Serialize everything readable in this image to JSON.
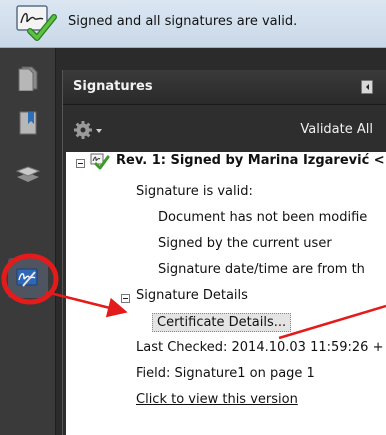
{
  "message_bar": {
    "text": "Signed and all signatures are valid."
  },
  "panel": {
    "title": "Signatures",
    "validate_all_label": "Validate All"
  },
  "signature_tree": {
    "revision_label": "Rev. 1: Signed by Marina Izgarević <",
    "signature_valid": "Signature is valid:",
    "doc_not_modified": "Document has not been modifie",
    "signed_by_current_user": "Signed by the current user",
    "signature_datetime": "Signature date/time are from th",
    "signature_details": "Signature Details",
    "certificate_details": "Certificate Details...",
    "last_checked": "Last Checked: 2014.10.03 11:59:26 +",
    "field": "Field: Signature1 on page 1",
    "click_to_view": "Click to view this version"
  },
  "icons": {
    "message_bar_icon": "signature-valid-icon",
    "rail": [
      "pages-icon",
      "bookmarks-icon",
      "layers-icon",
      "signatures-icon"
    ],
    "toolbar": "gear-icon",
    "tree": "signature-check-icon"
  },
  "colors": {
    "annotation": "#e31b1b",
    "valid_green": "#4cae3a"
  }
}
